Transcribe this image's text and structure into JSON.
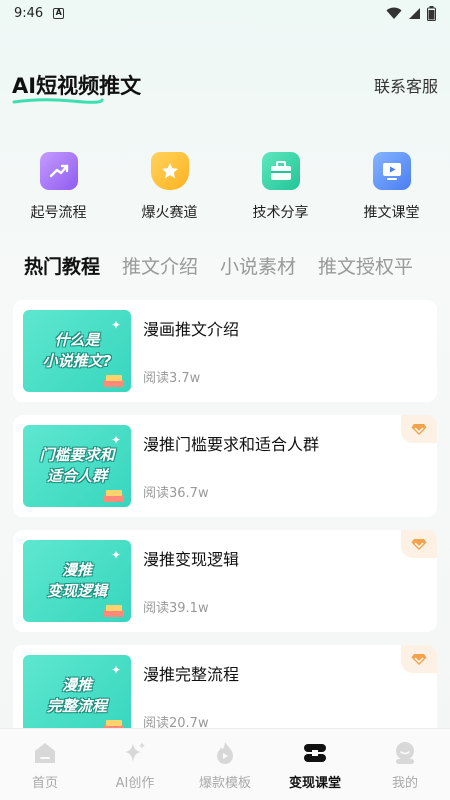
{
  "status": {
    "time": "9:46",
    "a_icon_text": "A"
  },
  "header": {
    "title": "AI短视频推文",
    "contact": "联系客服"
  },
  "quick_links": [
    {
      "label": "起号流程",
      "icon": "trending-up-icon",
      "color": "#a77bf7"
    },
    {
      "label": "爆火赛道",
      "icon": "star-badge-icon",
      "color": "#ffc333"
    },
    {
      "label": "技术分享",
      "icon": "briefcase-icon",
      "color": "#35d2a8"
    },
    {
      "label": "推文课堂",
      "icon": "play-screen-icon",
      "color": "#5b8ef6"
    }
  ],
  "tabs": [
    {
      "label": "热门教程",
      "active": true
    },
    {
      "label": "推文介绍",
      "active": false
    },
    {
      "label": "小说素材",
      "active": false
    },
    {
      "label": "推文授权平",
      "active": false
    }
  ],
  "articles": [
    {
      "thumb_line1": "什么是",
      "thumb_line2": "小说推文?",
      "title": "漫画推文介绍",
      "reads": "阅读3.7w",
      "vip": false
    },
    {
      "thumb_line1": "门槛要求和",
      "thumb_line2": "适合人群",
      "title": "漫推门槛要求和适合人群",
      "reads": "阅读36.7w",
      "vip": true
    },
    {
      "thumb_line1": "漫推",
      "thumb_line2": "变现逻辑",
      "title": "漫推变现逻辑",
      "reads": "阅读39.1w",
      "vip": true
    },
    {
      "thumb_line1": "漫推",
      "thumb_line2": "完整流程",
      "title": "漫推完整流程",
      "reads": "阅读20.7w",
      "vip": true
    }
  ],
  "bottom_nav": [
    {
      "label": "首页",
      "icon": "home-icon",
      "active": false
    },
    {
      "label": "AI创作",
      "icon": "sparkle-icon",
      "active": false
    },
    {
      "label": "爆款模板",
      "icon": "flame-icon",
      "active": false
    },
    {
      "label": "变现课堂",
      "icon": "stack-icon",
      "active": true
    },
    {
      "label": "我的",
      "icon": "profile-icon",
      "active": false
    }
  ]
}
